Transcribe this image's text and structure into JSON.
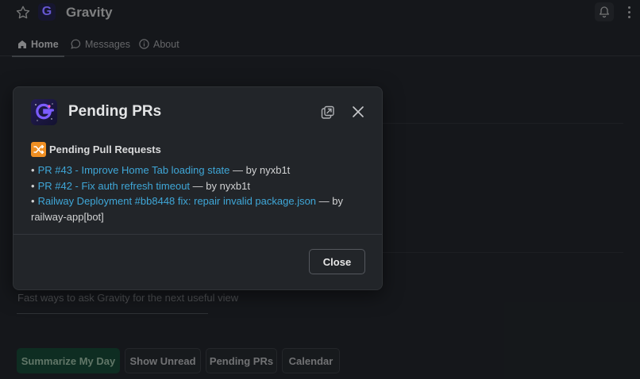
{
  "app": {
    "title": "Gravity",
    "logo_letter": "G",
    "icons": {
      "favorite": "star-icon",
      "notifications": "bell-icon",
      "more": "kebab-menu-icon"
    }
  },
  "tabs": [
    {
      "label": "Home",
      "icon": "home-icon",
      "active": true
    },
    {
      "label": "Messages",
      "icon": "chat-bubble-icon",
      "active": false
    },
    {
      "label": "About",
      "icon": "info-icon",
      "active": false
    }
  ],
  "background": {
    "hint": "Fast ways to ask Gravity for the next useful view",
    "quick_actions": [
      "Summarize My Day",
      "Show Unread",
      "Pending PRs",
      "Calendar"
    ]
  },
  "modal": {
    "title": "Pending PRs",
    "section_title": "Pending Pull Requests",
    "section_icon": "shuffle-icon",
    "items": [
      {
        "link": "PR #43 - Improve Home Tab loading state",
        "separator": " — by ",
        "author": "nyxb1t"
      },
      {
        "link": "PR #42 - Fix auth refresh timeout",
        "separator": " — by ",
        "author": "nyxb1t"
      },
      {
        "link": "Railway Deployment #bb8448 fix: repair invalid package.json",
        "separator": " — by ",
        "author": "railway-app[bot]"
      }
    ],
    "close_label": "Close",
    "icons": {
      "popout": "open-in-new-window-icon",
      "close": "close-icon"
    }
  },
  "colors": {
    "background": "#1a1d21",
    "modal": "#222529",
    "link": "#3fa7d8",
    "primary_action": "#12382a",
    "section_icon": "#ef8f23"
  }
}
